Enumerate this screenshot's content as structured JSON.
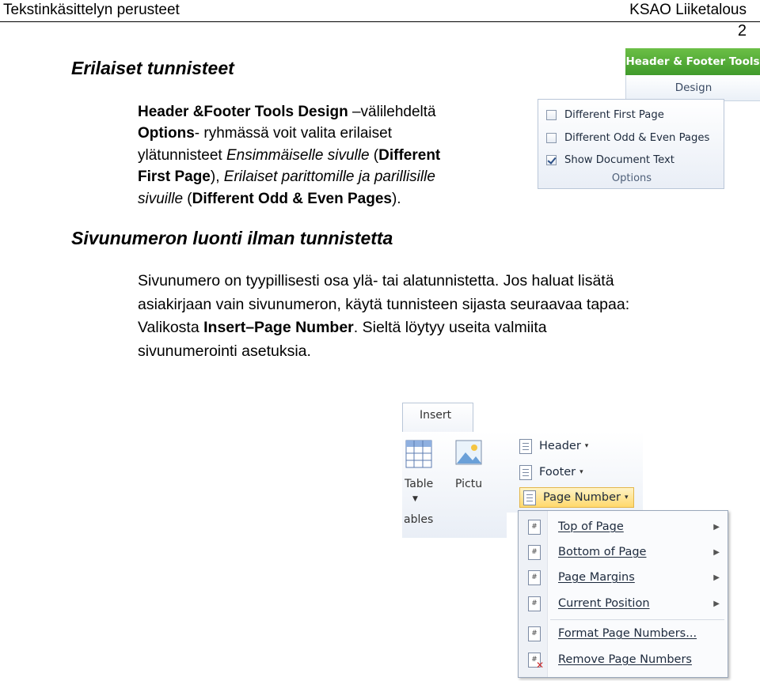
{
  "header": {
    "left": "Tekstinkäsittelyn perusteet",
    "right": "KSAO Liiketalous",
    "page_number": "2"
  },
  "section1": {
    "heading": "Erilaiset tunnisteet",
    "p1_bold": "Header &Footer Tools Design",
    "p1_t1": " –välilehdeltä",
    "p2_bold": "Options",
    "p2_t1": "- ryhmässä voit valita erilaiset",
    "p3_t1": "ylätunnisteet ",
    "p3_i1": "Ensimmäiselle sivulle",
    "p3_t2": " (",
    "p3_b1": "Different",
    "p4_b1": "First Page",
    "p4_t1": "), ",
    "p4_i1": "Erilaiset parittomille ja parillisille",
    "p5_i1": "sivuille",
    "p5_t1": " (",
    "p5_b1": "Different Odd & Even Pages",
    "p5_t2": ")."
  },
  "section2": {
    "heading": "Sivunumeron luonti ilman tunnistetta",
    "l1": "Sivunumero on tyypillisesti osa ylä- tai alatunnistetta. Jos haluat lisätä",
    "l2": "asiakirjaan vain sivunumeron, käytä tunnisteen sijasta seuraavaa tapaa:",
    "l3_t1": "Valikosta ",
    "l3_b1": "Insert–Page Number",
    "l3_t2": ". Sieltä löytyy useita valmiita",
    "l4": "sivunumerointi asetuksia."
  },
  "ribbon1": {
    "context_tab": "Header & Footer Tools",
    "tab": "Design",
    "options": [
      {
        "label": "Different First Page",
        "checked": false
      },
      {
        "label": "Different Odd & Even Pages",
        "checked": false
      },
      {
        "label": "Show Document Text",
        "checked": true
      }
    ],
    "group_label": "Options"
  },
  "ribbon2": {
    "tab": "Insert",
    "table_label": "Table",
    "table_arrow": "▼",
    "picture_label": "Pictu",
    "group_label": "ables",
    "header_label": "Header",
    "footer_label": "Footer",
    "page_number_label": "Page Number",
    "caret": "▾",
    "menu_items": [
      {
        "label": "Top of Page",
        "icon_text": "#",
        "submenu_arrow": "▶"
      },
      {
        "label": "Bottom of Page",
        "icon_text": "#",
        "submenu_arrow": "▶"
      },
      {
        "label": "Page Margins",
        "icon_text": "#",
        "submenu_arrow": "▶"
      },
      {
        "label": "Current Position",
        "icon_text": "#",
        "submenu_arrow": "▶"
      },
      {
        "label": "Format Page Numbers...",
        "icon_text": "#"
      },
      {
        "label": "Remove Page Numbers",
        "icon_text": "#",
        "badge": "✕"
      }
    ]
  }
}
